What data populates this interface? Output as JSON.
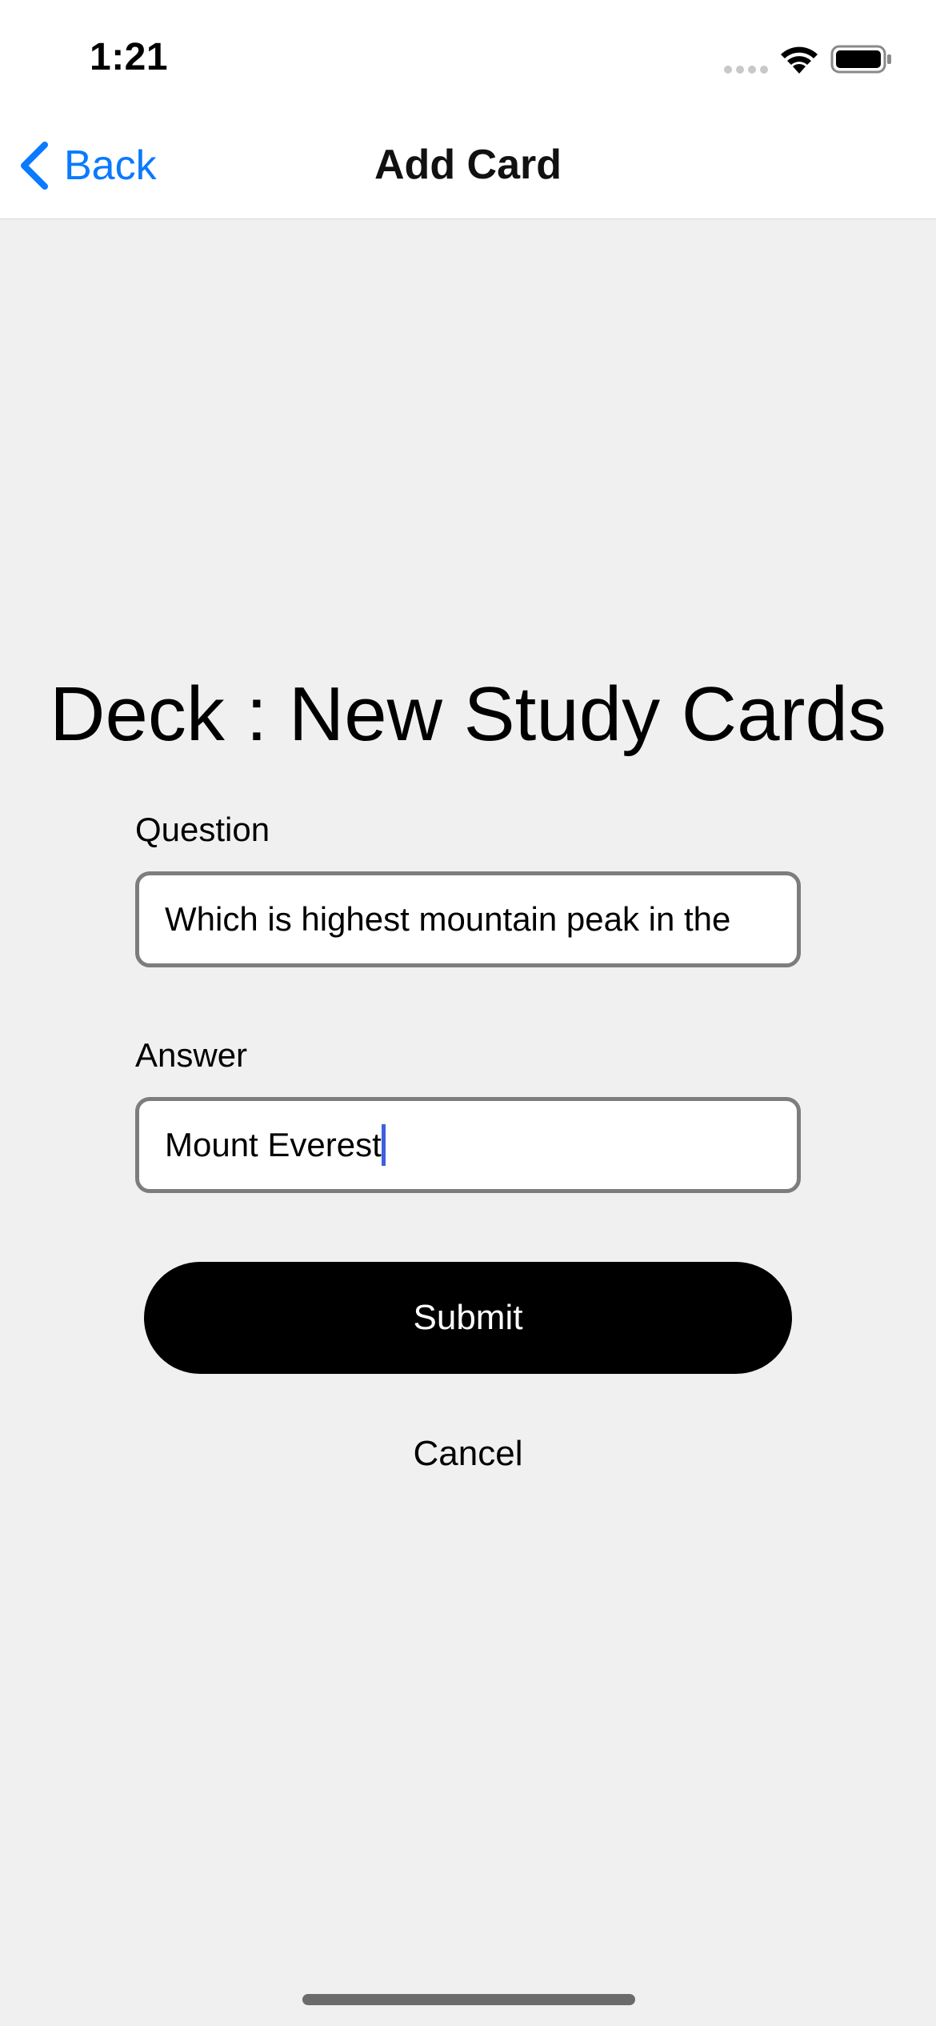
{
  "status_bar": {
    "time": "1:21",
    "icons": [
      "cellular-signal-icon",
      "wifi-icon",
      "battery-icon"
    ]
  },
  "nav": {
    "back_label": "Back",
    "title": "Add Card",
    "back_icon": "chevron-left-icon",
    "accent_color": "#0a7aff"
  },
  "form": {
    "deck_title": "Deck : New Study Cards",
    "question_label": "Question",
    "question_value": "Which is highest mountain peak in the",
    "answer_label": "Answer",
    "answer_value": "Mount Everest",
    "submit_label": "Submit",
    "cancel_label": "Cancel"
  },
  "colors": {
    "background": "#f0f0f0",
    "submit_background": "#000000",
    "field_border": "#7d7d7d",
    "caret": "#3e5fe0"
  }
}
